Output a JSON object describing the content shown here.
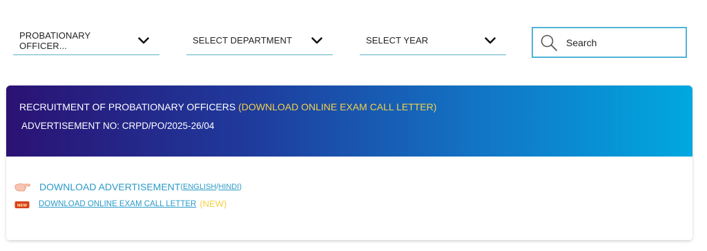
{
  "filters": {
    "post": {
      "selected": "PROBATIONARY OFFICER..."
    },
    "department": {
      "selected": "SELECT DEPARTMENT"
    },
    "year": {
      "selected": "SELECT YEAR"
    }
  },
  "search": {
    "placeholder": "Search",
    "value": ""
  },
  "card": {
    "title": "RECRUITMENT OF PROBATIONARY OFFICERS ",
    "title_highlight": "(DOWNLOAD ONLINE EXAM CALL LETTER)",
    "advertisement": "ADVERTISEMENT NO: CRPD/PO/2025-26/04",
    "download_advertisement": "DOWNLOAD ADVERTISEMENT",
    "paren_open": "(",
    "english": "ENGLISH",
    "slash": "/",
    "hindi": "HINDI",
    "paren_close": ")",
    "call_letter_link": "DOWNLOAD ONLINE EXAM CALL LETTER",
    "new_tag": "(NEW)",
    "new_badge": "NEW"
  },
  "colors": {
    "accent": "#4fb3d6",
    "link": "#2b9ac8",
    "highlight": "#f2d24a",
    "header_start": "#2a1273",
    "header_end": "#00a8e0"
  },
  "icons": {
    "dropdown": "chevron-down-icon",
    "search": "search-icon",
    "pointer": "pointing-hand-icon",
    "new": "new-badge-icon"
  }
}
